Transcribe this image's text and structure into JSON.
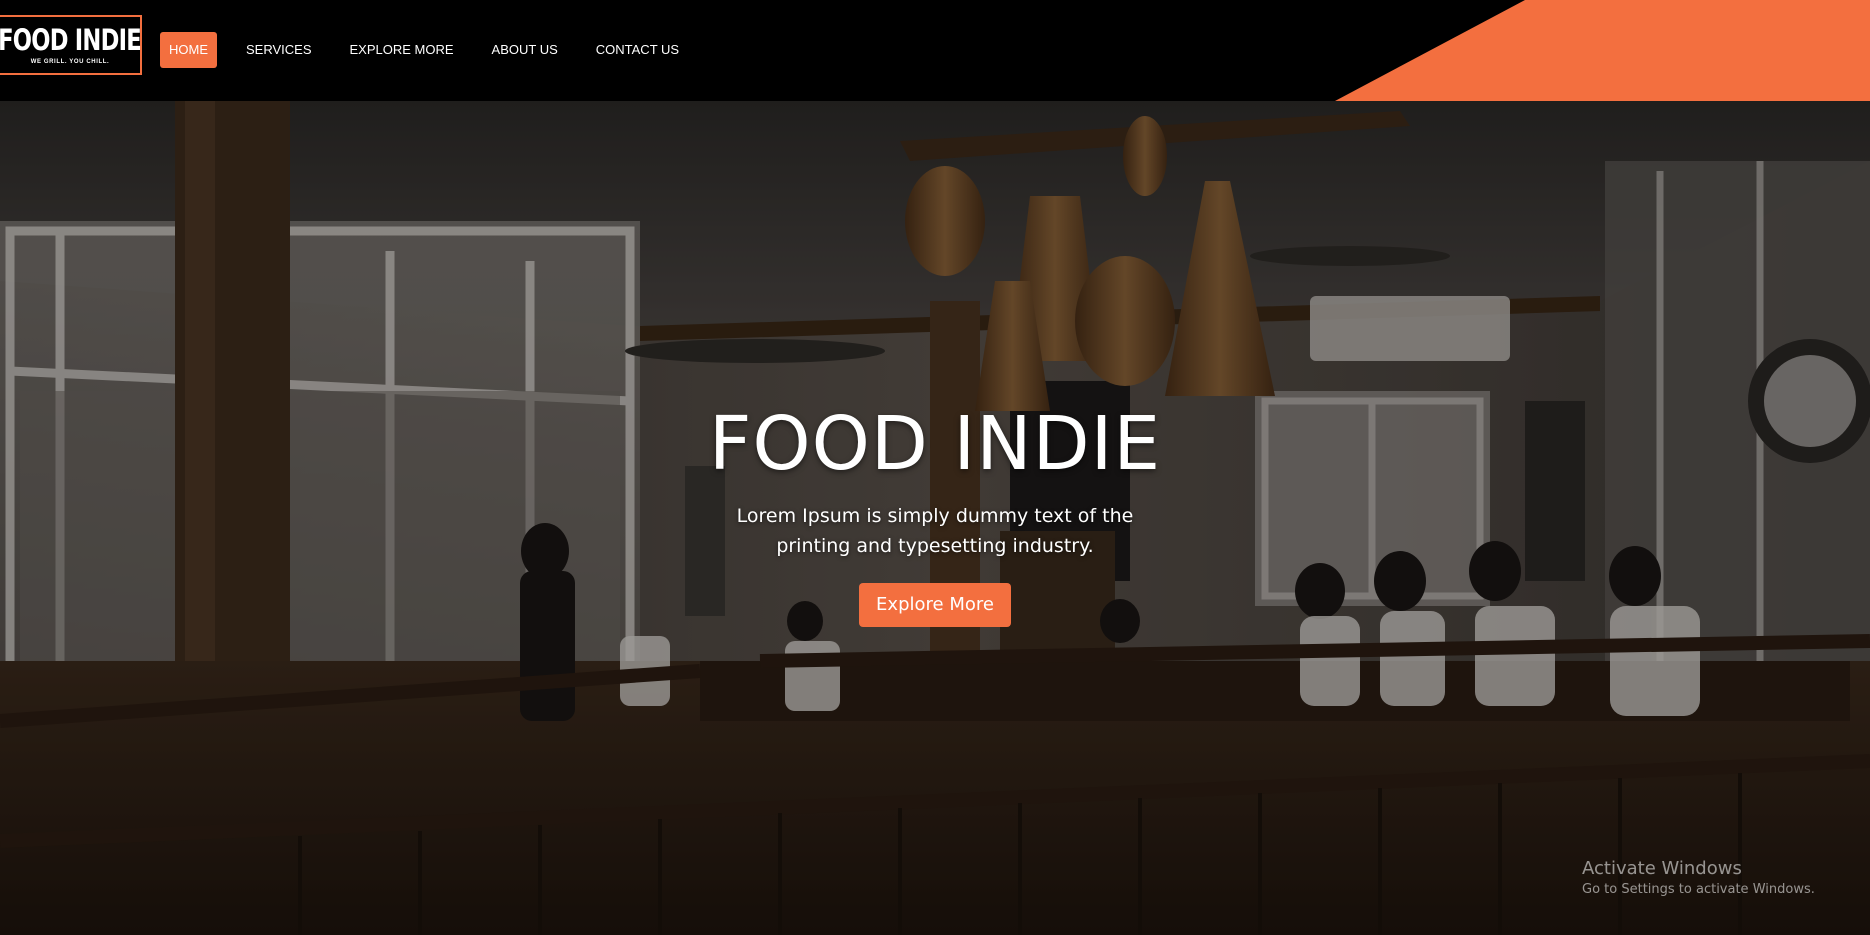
{
  "brand": {
    "name": "FOOD INDIE",
    "tagline": "WE GRILL. YOU CHILL.",
    "accent_color": "#f36f3f"
  },
  "nav": {
    "items": [
      {
        "label": "HOME",
        "active": true
      },
      {
        "label": "SERVICES",
        "active": false
      },
      {
        "label": "EXPLORE MORE",
        "active": false
      },
      {
        "label": "ABOUT US",
        "active": false
      },
      {
        "label": "CONTACT US",
        "active": false
      }
    ]
  },
  "hero": {
    "title": "FOOD INDIE",
    "subtitle": "Lorem Ipsum is simply dummy text of the printing and typesetting industry.",
    "button_label": "Explore More",
    "background": "restaurant-interior-photo"
  },
  "watermark": {
    "title": "Activate Windows",
    "subtitle": "Go to Settings to activate Windows."
  }
}
